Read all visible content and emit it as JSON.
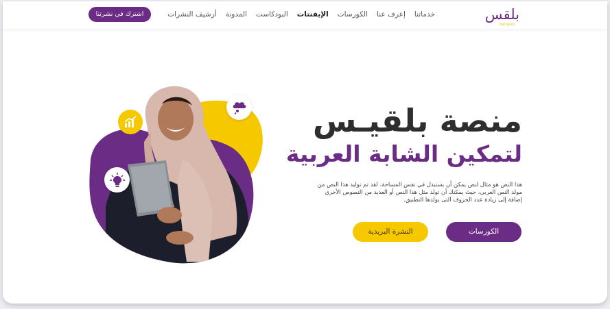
{
  "nav": {
    "logo_text": "بلقس",
    "logo_sub": "balqees",
    "items": [
      {
        "label": "خدماتنا",
        "active": false
      },
      {
        "label": "إعرف عنا",
        "active": false
      },
      {
        "label": "الكورسات",
        "active": false
      },
      {
        "label": "الإيفنتات",
        "active": true
      },
      {
        "label": "البودكاست",
        "active": false
      },
      {
        "label": "المدونة",
        "active": false
      },
      {
        "label": "أرشيف النشرات",
        "active": false
      }
    ],
    "subscribe_label": "اشترك في نشرتنا"
  },
  "hero": {
    "title": "منصة بلقيـس",
    "subtitle": "لتمكين الشابة العربية",
    "paragraph": "هذا النص هو مثال لنص يمكن أن يستبدل في نفس المساحة، لقد تم توليد هذا النص من مولد النص العربى، حيث يمكنك أن تولد مثل هذا النص أو العديد من النصوص الأخرى إضافة إلى زيادة عدد الحروف التى يولدها التطبيق.",
    "btn_courses": "الكورسات",
    "btn_newsletter": "النشرة البريدية"
  },
  "colors": {
    "brand_purple": "#6b2c85",
    "accent_yellow": "#f5c800"
  },
  "icons": [
    "chart-growth-icon",
    "thought-bubble-icon",
    "lightbulb-icon"
  ]
}
